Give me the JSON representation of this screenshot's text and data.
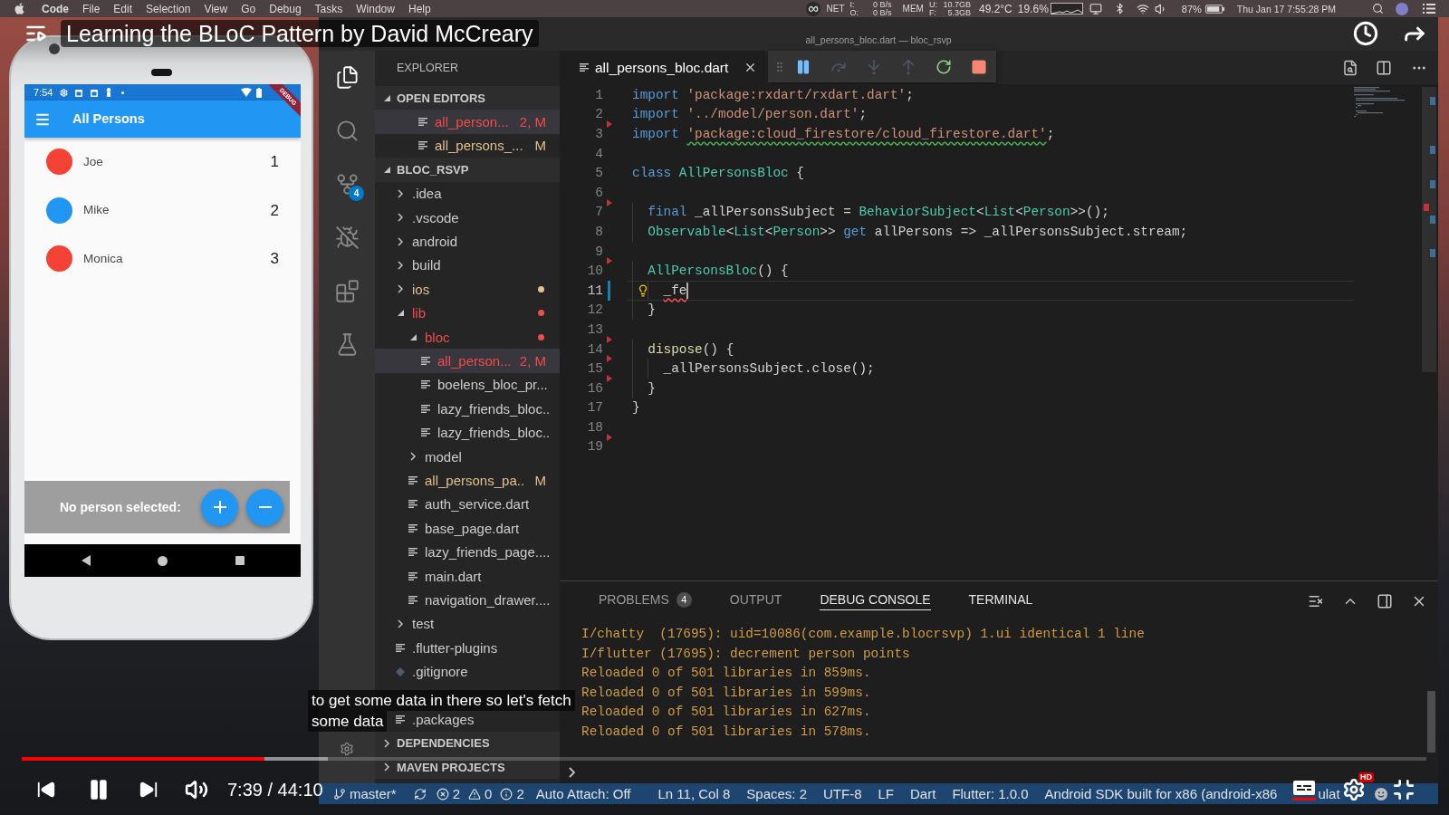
{
  "menu_bar": {
    "app": "Code",
    "menus": [
      "File",
      "Edit",
      "Selection",
      "View",
      "Go",
      "Debug",
      "Tasks",
      "Window",
      "Help"
    ],
    "net": {
      "label": "NET",
      "rows": [
        {
          "key": "I:",
          "value": "0 B/s"
        },
        {
          "key": "O:",
          "value": "0 B/s"
        }
      ]
    },
    "mem": {
      "label": "MEM",
      "rows": [
        {
          "key": "U:",
          "value": "10.7GB"
        },
        {
          "key": "F:",
          "value": "5.3GB"
        }
      ]
    },
    "temperature": "49.2°C",
    "cpu": "19.6%",
    "battery": "87%",
    "clock": "Thu Jan 17 7:55:28 PM"
  },
  "phone": {
    "clock": "7:54",
    "banner": "DEBUG",
    "title": "All Persons",
    "persons": [
      {
        "name": "Joe",
        "count": "1",
        "color": "#f44336"
      },
      {
        "name": "Mike",
        "count": "2",
        "color": "#2196f3"
      },
      {
        "name": "Monica",
        "count": "3",
        "color": "#f44336"
      }
    ],
    "footer_label": "No person selected:",
    "actions": [
      {
        "kind": "plus"
      },
      {
        "kind": "minus"
      }
    ]
  },
  "editor_window": {
    "window_title": "all_persons_bloc.dart — bloc_rsvp",
    "activity_bar": [
      {
        "kind": "files",
        "selected": true
      },
      {
        "kind": "search",
        "selected": false
      },
      {
        "kind": "source_control",
        "selected": false,
        "badge": "4"
      },
      {
        "kind": "debug",
        "selected": false
      },
      {
        "kind": "extensions",
        "selected": false
      },
      {
        "kind": "test",
        "selected": false
      }
    ],
    "sidebar": {
      "title": "EXPLORER",
      "sections": [
        {
          "kind": "open_editors",
          "title": "OPEN EDITORS",
          "expanded": true,
          "items": [
            {
              "kind": "file",
              "name": "all_person...",
              "badge": "2, M",
              "color": "#f14c4c",
              "selected": true
            },
            {
              "kind": "file",
              "name": "all_persons_...",
              "badge": "M",
              "color": "#e2c08d",
              "selected": false
            }
          ]
        },
        {
          "kind": "folder",
          "title": "BLOC_RSVP",
          "expanded": true,
          "items": [
            {
              "kind": "folder",
              "name": ".idea",
              "expanded": false,
              "selected": false
            },
            {
              "kind": "folder",
              "name": ".vscode",
              "expanded": false,
              "selected": false
            },
            {
              "kind": "folder",
              "name": "android",
              "expanded": false,
              "selected": false
            },
            {
              "kind": "folder",
              "name": "build",
              "expanded": false,
              "selected": false
            },
            {
              "kind": "folder",
              "name": "ios",
              "expanded": false,
              "selected": false,
              "color": "#e2c08d"
            },
            {
              "kind": "folder",
              "name": "lib",
              "expanded": true,
              "selected": false,
              "color": "#f14c4c",
              "children": [
                {
                  "kind": "folder",
                  "name": "bloc",
                  "expanded": true,
                  "selected": false,
                  "color": "#f14c4c",
                  "children": [
                    {
                      "kind": "file",
                      "name": "all_person...",
                      "badge": "2, M",
                      "color": "#f14c4c",
                      "selected": true
                    },
                    {
                      "kind": "file",
                      "name": "boelens_bloc_pr...",
                      "selected": false
                    },
                    {
                      "kind": "file",
                      "name": "lazy_friends_bloc..",
                      "selected": false
                    },
                    {
                      "kind": "file",
                      "name": "lazy_friends_bloc..",
                      "selected": false
                    }
                  ]
                },
                {
                  "kind": "folder",
                  "name": "model",
                  "expanded": false,
                  "selected": false
                },
                {
                  "kind": "file",
                  "name": "all_persons_pa..",
                  "badge": "M",
                  "color": "#e2c08d",
                  "selected": false
                },
                {
                  "kind": "file",
                  "name": "auth_service.dart",
                  "selected": false
                },
                {
                  "kind": "file",
                  "name": "base_page.dart",
                  "selected": false
                },
                {
                  "kind": "file",
                  "name": "lazy_friends_page....",
                  "selected": false
                },
                {
                  "kind": "file",
                  "name": "main.dart",
                  "selected": false
                },
                {
                  "kind": "file",
                  "name": "navigation_drawer....",
                  "selected": false
                }
              ]
            },
            {
              "kind": "folder",
              "name": "test",
              "expanded": false,
              "selected": false
            },
            {
              "kind": "file",
              "name": ".flutter-plugins",
              "selected": false
            },
            {
              "kind": "git_file",
              "name": ".gitignore",
              "selected": false
            },
            {
              "kind": "file",
              "name": ".packages",
              "selected": false
            }
          ]
        },
        {
          "kind": "view",
          "title": "DEPENDENCIES",
          "expanded": false
        },
        {
          "kind": "view",
          "title": "MAVEN PROJECTS",
          "expanded": false
        }
      ]
    },
    "tabs": [
      {
        "label": "all_persons_bloc.dart",
        "selected": true
      }
    ],
    "debug_toolbar": [
      {
        "kind": "pause",
        "disabled": false
      },
      {
        "kind": "step_over",
        "disabled": true
      },
      {
        "kind": "step_into",
        "disabled": true
      },
      {
        "kind": "step_out",
        "disabled": true
      },
      {
        "kind": "restart",
        "disabled": false
      },
      {
        "kind": "stop",
        "disabled": false
      }
    ],
    "code": [
      {
        "number": "1",
        "current": false,
        "tokens": [
          {
            "kind": "keyword",
            "text": "import "
          },
          {
            "kind": "string",
            "text": "'package:rxdart/rxdart.dart'"
          },
          {
            "kind": "plain",
            "text": ";"
          }
        ]
      },
      {
        "number": "2",
        "current": false,
        "tokens": [
          {
            "kind": "keyword",
            "text": "import "
          },
          {
            "kind": "string",
            "text": "'../model/person.dart'"
          },
          {
            "kind": "plain",
            "text": ";"
          }
        ]
      },
      {
        "number": "3",
        "current": false,
        "gutter": {
          "kind": "deleted"
        },
        "tokens": [
          {
            "kind": "keyword",
            "text": "import "
          },
          {
            "kind": "string",
            "text": "'package:cloud_firestore/cloud_firestore.dart'",
            "squiggle": {
              "kind": "warning"
            }
          },
          {
            "kind": "plain",
            "text": ";"
          }
        ]
      },
      {
        "number": "4",
        "current": false
      },
      {
        "number": "5",
        "current": false,
        "tokens": [
          {
            "kind": "keyword",
            "text": "class "
          },
          {
            "kind": "type",
            "text": "AllPersonsBloc"
          },
          {
            "kind": "plain",
            "text": " {"
          }
        ]
      },
      {
        "number": "6",
        "current": false
      },
      {
        "number": "7",
        "current": false,
        "gutter": {
          "kind": "deleted"
        },
        "tokens": [
          {
            "kind": "keyword",
            "text": "  final "
          },
          {
            "kind": "plain",
            "text": "_allPersonsSubject = "
          },
          {
            "kind": "type",
            "text": "BehaviorSubject"
          },
          {
            "kind": "plain",
            "text": "<"
          },
          {
            "kind": "type",
            "text": "List"
          },
          {
            "kind": "plain",
            "text": "<"
          },
          {
            "kind": "type",
            "text": "Person"
          },
          {
            "kind": "plain",
            "text": ">>();"
          }
        ]
      },
      {
        "number": "8",
        "current": false,
        "tokens": [
          {
            "kind": "type",
            "text": "  Observable"
          },
          {
            "kind": "plain",
            "text": "<"
          },
          {
            "kind": "type",
            "text": "List"
          },
          {
            "kind": "plain",
            "text": "<"
          },
          {
            "kind": "type",
            "text": "Person"
          },
          {
            "kind": "plain",
            "text": ">> "
          },
          {
            "kind": "keyword",
            "text": "get "
          },
          {
            "kind": "plain",
            "text": "allPersons => _allPersonsSubject.stream;"
          }
        ]
      },
      {
        "number": "9",
        "current": false
      },
      {
        "number": "10",
        "current": false,
        "gutter": {
          "kind": "deleted"
        },
        "tokens": [
          {
            "kind": "type",
            "text": "  AllPersonsBloc"
          },
          {
            "kind": "plain",
            "text": "() {"
          }
        ]
      },
      {
        "number": "11",
        "current": true,
        "gutter": {
          "kind": "modified"
        },
        "tokens": [
          {
            "kind": "lightbulb"
          },
          {
            "kind": "plain",
            "text": "    _fe",
            "squiggle": {
              "kind": "error"
            }
          },
          {
            "kind": "cursor"
          }
        ]
      },
      {
        "number": "12",
        "current": false,
        "tokens": [
          {
            "kind": "plain",
            "text": "  }"
          }
        ]
      },
      {
        "number": "13",
        "current": false
      },
      {
        "number": "14",
        "current": false,
        "gutter": {
          "kind": "deleted"
        },
        "tokens": [
          {
            "kind": "function",
            "text": "  dispose"
          },
          {
            "kind": "plain",
            "text": "() {"
          }
        ]
      },
      {
        "number": "15",
        "current": false,
        "gutter": {
          "kind": "deleted"
        },
        "tokens": [
          {
            "kind": "plain",
            "text": "    _allPersonsSubject.close();"
          }
        ]
      },
      {
        "number": "16",
        "current": false,
        "gutter": {
          "kind": "deleted"
        },
        "tokens": [
          {
            "kind": "plain",
            "text": "  }"
          }
        ]
      },
      {
        "number": "17",
        "current": false,
        "tokens": [
          {
            "kind": "plain",
            "text": "}"
          }
        ]
      },
      {
        "number": "18",
        "current": false
      },
      {
        "number": "19",
        "current": false,
        "gutter": {
          "kind": "deleted"
        }
      }
    ],
    "panel": {
      "tabs": [
        {
          "label": "PROBLEMS",
          "badge": "4",
          "selected": false,
          "hovered": false
        },
        {
          "label": "OUTPUT",
          "selected": false,
          "hovered": false
        },
        {
          "label": "DEBUG CONSOLE",
          "selected": true,
          "hovered": false
        },
        {
          "label": "TERMINAL",
          "selected": false,
          "hovered": true
        }
      ],
      "console": [
        "I/chatty  (17695): uid=10086(com.example.blocrsvp) 1.ui identical 1 line",
        "I/flutter (17695): decrement person points",
        "Reloaded 0 of 501 libraries in 859ms.",
        "Reloaded 0 of 501 libraries in 599ms.",
        "Reloaded 0 of 501 libraries in 627ms.",
        "Reloaded 0 of 501 libraries in 578ms."
      ]
    },
    "status_bar": {
      "branch": "master*",
      "problems": [
        {
          "kind": "error",
          "count": "2"
        },
        {
          "kind": "warning",
          "count": "0"
        },
        {
          "kind": "info",
          "count": "2"
        }
      ],
      "items": [
        "Auto Attach: Off",
        "Ln 11, Col 8",
        "Spaces: 2",
        "UTF-8",
        "LF",
        "Dart",
        "Flutter: 1.0.0",
        "Android SDK built for x86 (android-x86",
        "ulat"
      ]
    }
  },
  "video": {
    "title": "Learning the BLoC Pattern by David McCreary",
    "captions": [
      "to get some data in there so let's fetch",
      "some data"
    ],
    "progress": {
      "level": 0.173
    },
    "buffer": {
      "level": 0.218
    },
    "playing": true,
    "time": "7:39 / 44:10",
    "captions_on": true,
    "quality_badge": "HD"
  }
}
